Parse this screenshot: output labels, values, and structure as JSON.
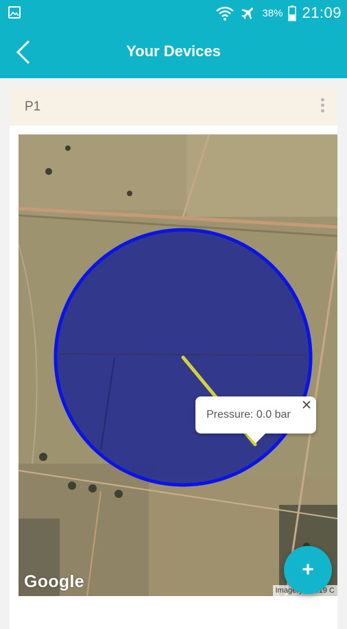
{
  "statusbar": {
    "battery_percent": "38%",
    "time": "21:09",
    "icons": [
      "gallery-icon",
      "wifi-icon",
      "airplane-icon",
      "battery-icon"
    ]
  },
  "appbar": {
    "title": "Your Devices",
    "back_icon": "back-arrow-icon"
  },
  "device": {
    "name": "P1",
    "menu_icon": "more-vertical-icon"
  },
  "map": {
    "logo": "Google",
    "attribution": "Imagery ©2019 C",
    "infowindow": {
      "text": "Pressure: 0.0 bar",
      "close_icon": "close-icon"
    },
    "colors": {
      "circle_fill": "#27308f",
      "circle_stroke": "#0a14e8",
      "pivot_arm": "#d4d23a"
    }
  },
  "fab": {
    "label": "+",
    "icon": "add-icon"
  },
  "colors": {
    "primary": "#0fb4c9",
    "card_header": "#f8f1e6"
  }
}
